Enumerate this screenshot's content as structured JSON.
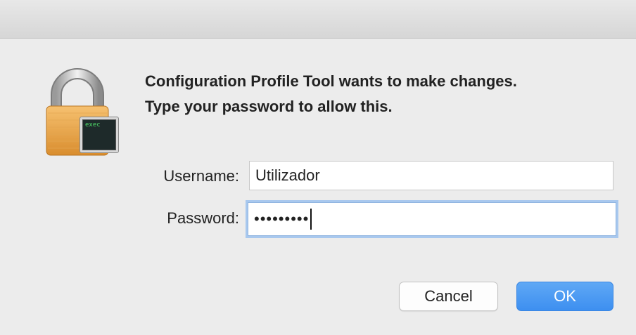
{
  "dialog": {
    "message_line1": "Configuration Profile Tool wants to make changes.",
    "message_line2": "Type your password to allow this.",
    "icon": "padlock-exec-icon",
    "icon_badge": "exec"
  },
  "form": {
    "username_label": "Username:",
    "username_value": "Utilizador",
    "password_label": "Password:",
    "password_masked": "•••••••••"
  },
  "buttons": {
    "cancel_label": "Cancel",
    "ok_label": "OK"
  },
  "colors": {
    "background": "#ececec",
    "accent": "#3d8ff0",
    "focus_ring": "#a8c8ee"
  }
}
